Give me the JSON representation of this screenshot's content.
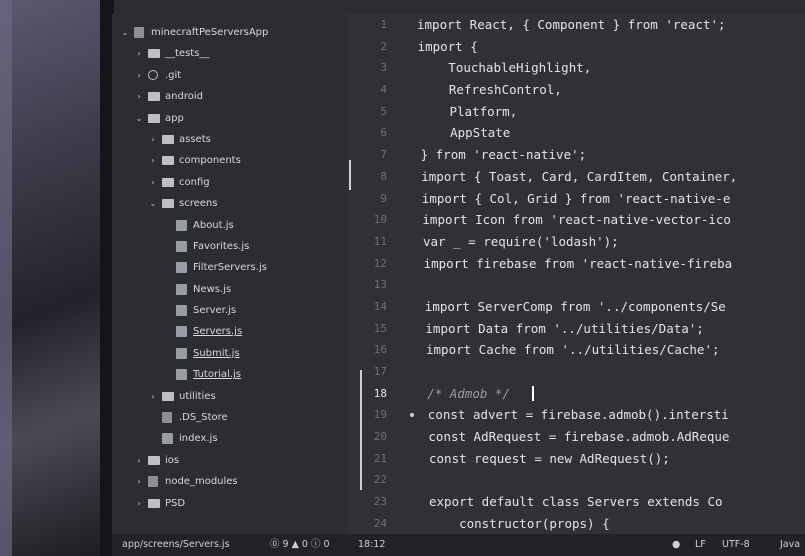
{
  "tree": [
    {
      "label": "minecraftPeServersApp",
      "arrow": "⌄",
      "icon": "gen"
    },
    {
      "label": "__tests__",
      "arrow": "›",
      "icon": "folder"
    },
    {
      "label": ".git",
      "arrow": "›",
      "icon": "git"
    },
    {
      "label": "android",
      "arrow": "›",
      "icon": "folder"
    },
    {
      "label": "app",
      "arrow": "⌄",
      "icon": "folder"
    },
    {
      "label": "assets",
      "arrow": "›",
      "icon": "folder"
    },
    {
      "label": "components",
      "arrow": "›",
      "icon": "folder"
    },
    {
      "label": "config",
      "arrow": "›",
      "icon": "folder"
    },
    {
      "label": "screens",
      "arrow": "⌄",
      "icon": "folder"
    },
    {
      "label": "About.js",
      "arrow": "",
      "icon": "js"
    },
    {
      "label": "Favorites.js",
      "arrow": "",
      "icon": "js"
    },
    {
      "label": "FilterServers.js",
      "arrow": "",
      "icon": "js"
    },
    {
      "label": "News.js",
      "arrow": "",
      "icon": "js"
    },
    {
      "label": "Server.js",
      "arrow": "",
      "icon": "js"
    },
    {
      "label": "Servers.js",
      "arrow": "",
      "icon": "js",
      "selected": true
    },
    {
      "label": "Submit.js",
      "arrow": "",
      "icon": "js",
      "selected": true
    },
    {
      "label": "Tutorial.js",
      "arrow": "",
      "icon": "js",
      "selected": true
    },
    {
      "label": "utilities",
      "arrow": "›",
      "icon": "folder"
    },
    {
      "label": ".DS_Store",
      "arrow": "",
      "icon": "gen"
    },
    {
      "label": "index.js",
      "arrow": "",
      "icon": "js"
    },
    {
      "label": "ios",
      "arrow": "›",
      "icon": "folder"
    },
    {
      "label": "node_modules",
      "arrow": "›",
      "icon": "gen"
    },
    {
      "label": "PSD",
      "arrow": "›",
      "icon": "folder"
    }
  ],
  "code": [
    {
      "n": "1",
      "t": "import React, { Component } from 'react';"
    },
    {
      "n": "2",
      "t": "import {"
    },
    {
      "n": "3",
      "t": "    TouchableHighlight,"
    },
    {
      "n": "4",
      "t": "    RefreshControl,"
    },
    {
      "n": "5",
      "t": "    Platform,"
    },
    {
      "n": "6",
      "t": "    AppState"
    },
    {
      "n": "7",
      "t": "} from 'react-native';"
    },
    {
      "n": "8",
      "t": "import { Toast, Card, CardItem, Container,"
    },
    {
      "n": "9",
      "t": "import { Col, Grid } from 'react-native-e"
    },
    {
      "n": "10",
      "t": "import Icon from 'react-native-vector-ico"
    },
    {
      "n": "11",
      "t": "var _ = require('lodash');"
    },
    {
      "n": "12",
      "t": "import firebase from 'react-native-fireba"
    },
    {
      "n": "13",
      "t": ""
    },
    {
      "n": "14",
      "t": "import ServerComp from '../components/Se"
    },
    {
      "n": "15",
      "t": "import Data from '../utilities/Data';"
    },
    {
      "n": "16",
      "t": "import Cache from '../utilities/Cache';"
    },
    {
      "n": "17",
      "t": ""
    },
    {
      "n": "18",
      "t": "/* Admob */",
      "comment": true,
      "current": true
    },
    {
      "n": "19",
      "t": "const advert = firebase.admob().intersti",
      "dot": true
    },
    {
      "n": "20",
      "t": "const AdRequest = firebase.admob.AdReque"
    },
    {
      "n": "21",
      "t": "const request = new AdRequest();"
    },
    {
      "n": "22",
      "t": ""
    },
    {
      "n": "23",
      "t": "export default class Servers extends Co"
    },
    {
      "n": "24",
      "t": "    constructor(props) {"
    }
  ],
  "status": {
    "path": "app/screens/Servers.js",
    "counts": "⓪ 9 ▲ 0 ⓘ 0",
    "cursor": "18:12",
    "dot": "●",
    "eol": "LF",
    "encoding": "UTF-8",
    "grammar": "Java"
  }
}
